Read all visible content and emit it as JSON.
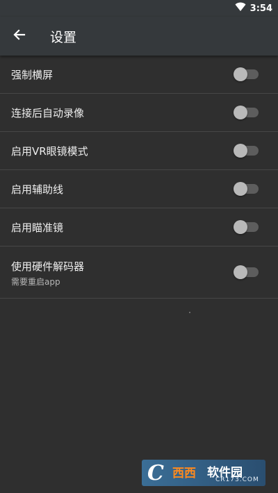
{
  "status_bar": {
    "time": "3:54",
    "wifi_icon": "wifi-icon"
  },
  "header": {
    "back_icon": "arrow-left-icon",
    "title": "设置"
  },
  "settings": [
    {
      "label": "强制横屏",
      "enabled": false
    },
    {
      "label": "连接后自动录像",
      "enabled": false
    },
    {
      "label": "启用VR眼镜模式",
      "enabled": false
    },
    {
      "label": "启用辅助线",
      "enabled": false
    },
    {
      "label": "启用瞄准镜",
      "enabled": false
    },
    {
      "label": "使用硬件解码器",
      "subtitle": "需要重启app",
      "enabled": false
    }
  ],
  "watermark": {
    "logo_letter": "C",
    "brand": "西西",
    "text": "软件园",
    "url": "CR173.COM"
  },
  "colors": {
    "background": "#2f2f2f",
    "app_bar": "#35393c",
    "divider": "#474747",
    "toggle_track_off": "#5d5d5d",
    "toggle_thumb_off": "#b9b9b9"
  }
}
